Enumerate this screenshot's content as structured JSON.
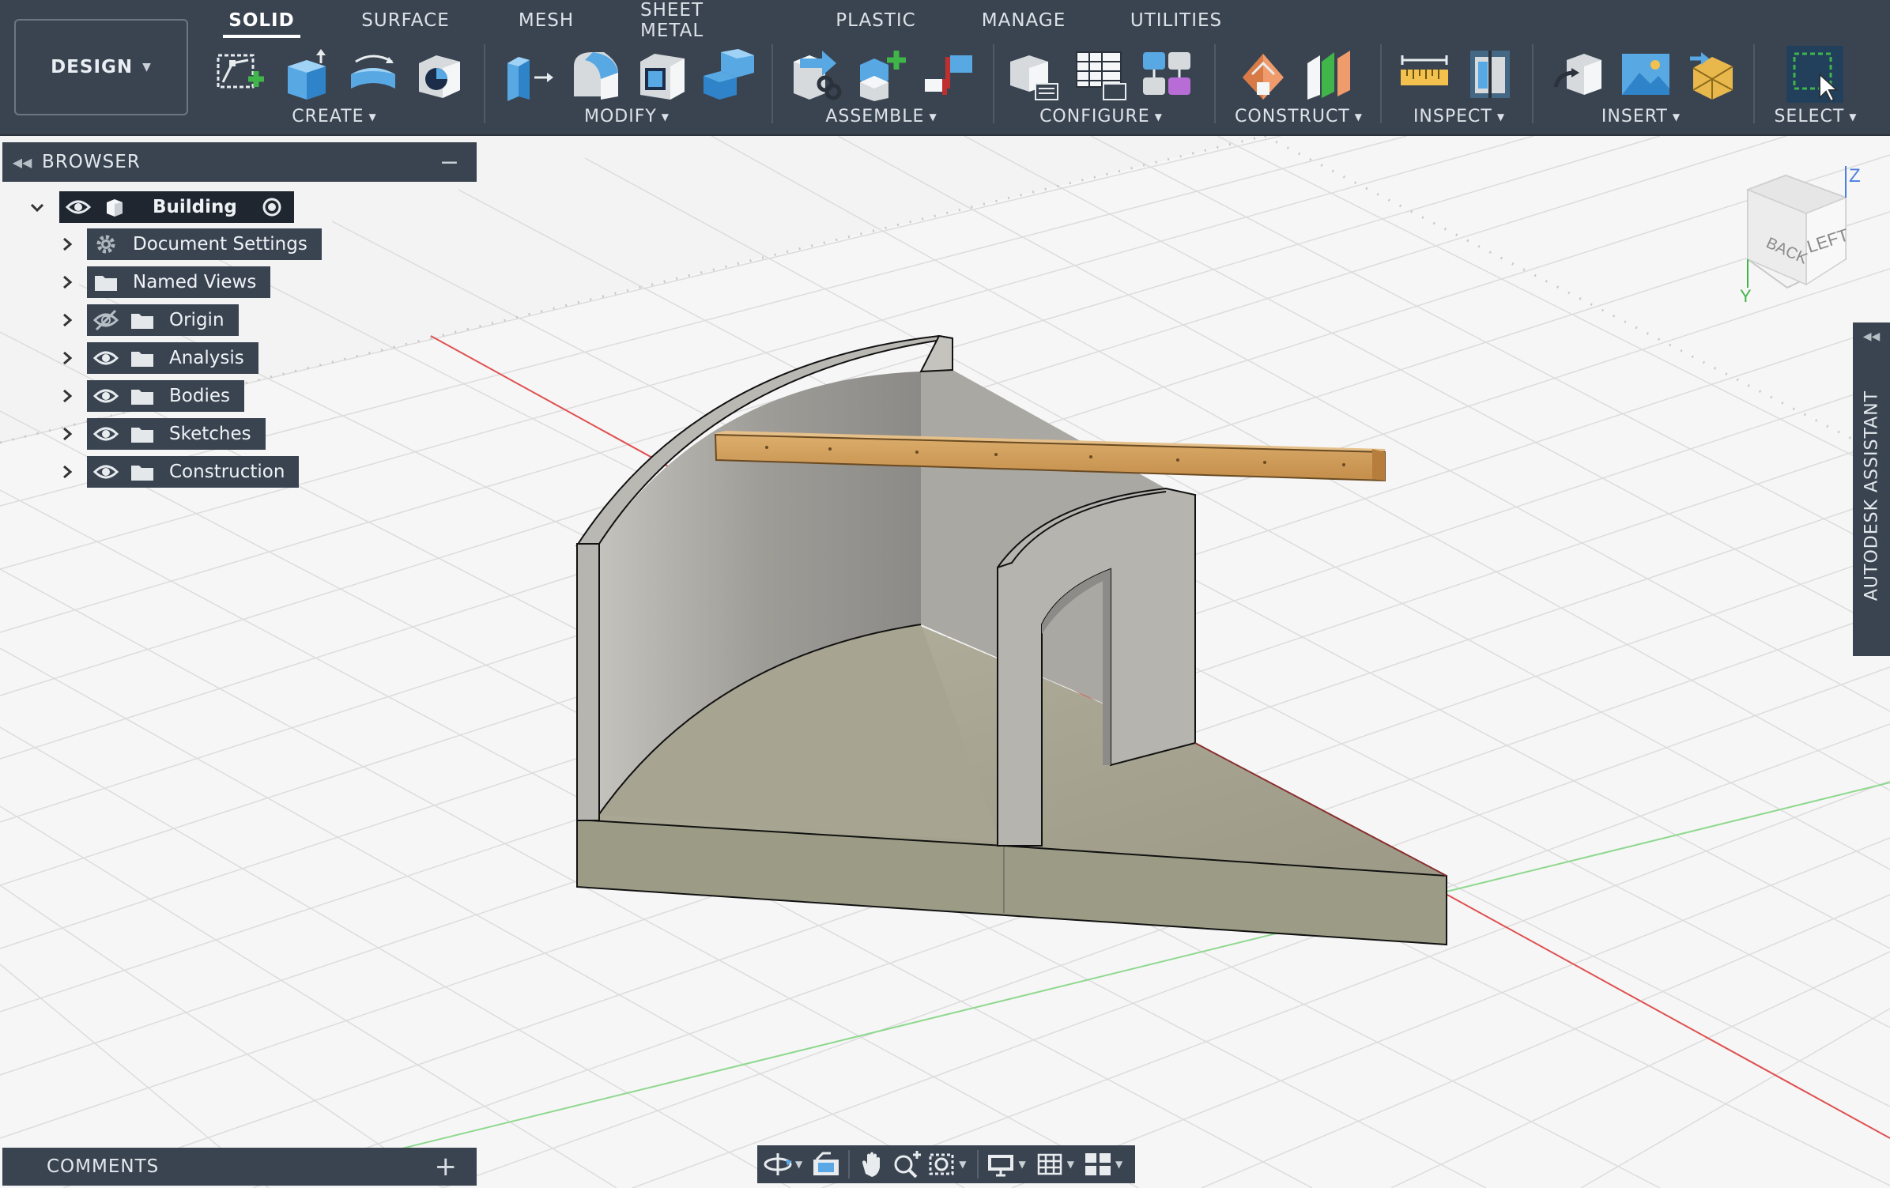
{
  "workspace": {
    "label": "DESIGN"
  },
  "tabs": [
    {
      "label": "SOLID",
      "active": true
    },
    {
      "label": "SURFACE"
    },
    {
      "label": "MESH"
    },
    {
      "label": "SHEET METAL"
    },
    {
      "label": "PLASTIC"
    },
    {
      "label": "MANAGE"
    },
    {
      "label": "UTILITIES"
    }
  ],
  "groups": {
    "create": {
      "label": "CREATE",
      "icons": [
        "create-sketch-icon",
        "extrude-icon",
        "revolve-icon",
        "hole-icon"
      ]
    },
    "modify": {
      "label": "MODIFY",
      "icons": [
        "press-pull-icon",
        "fillet-icon",
        "shell-icon",
        "combine-icon"
      ]
    },
    "assemble": {
      "label": "ASSEMBLE",
      "icons": [
        "joint-icon",
        "new-component-icon",
        "as-built-joint-icon"
      ]
    },
    "configure": {
      "label": "CONFIGURE",
      "icons": [
        "configure-component-icon",
        "configuration-table-icon",
        "configuration-rule-icon"
      ]
    },
    "construct": {
      "label": "CONSTRUCT",
      "icons": [
        "offset-plane-icon",
        "midplane-icon"
      ]
    },
    "inspect": {
      "label": "INSPECT",
      "icons": [
        "measure-icon",
        "section-analysis-icon"
      ]
    },
    "insert": {
      "label": "INSERT",
      "icons": [
        "insert-derive-icon",
        "insert-canvas-icon",
        "insert-mesh-icon"
      ]
    },
    "select": {
      "label": "SELECT",
      "icons": [
        "window-select-icon"
      ]
    }
  },
  "browser": {
    "title": "BROWSER",
    "root": {
      "label": "Building"
    },
    "items": [
      {
        "label": "Document Settings",
        "icon": "gear-icon"
      },
      {
        "label": "Named Views",
        "icon": "folder-icon"
      },
      {
        "label": "Origin",
        "icon": "folder-icon",
        "visibility": "hidden"
      },
      {
        "label": "Analysis",
        "icon": "folder-icon",
        "visibility": "visible"
      },
      {
        "label": "Bodies",
        "icon": "folder-icon",
        "visibility": "visible"
      },
      {
        "label": "Sketches",
        "icon": "folder-icon",
        "visibility": "visible"
      },
      {
        "label": "Construction",
        "icon": "folder-icon",
        "visibility": "visible"
      }
    ]
  },
  "comments": {
    "label": "COMMENTS"
  },
  "assistant": {
    "label": "AUTODESK ASSISTANT"
  },
  "viewcube": {
    "face_back": "BACK",
    "face_left": "LEFT",
    "axis_z": "Z",
    "axis_y": "Y"
  },
  "navbar": {
    "tools": [
      "orbit-icon",
      "look-at-icon",
      "pan-icon",
      "zoom-icon",
      "fit-icon",
      "display-settings-icon",
      "grid-settings-icon",
      "viewports-icon"
    ]
  },
  "colors": {
    "toolbar_bg": "#3a4451",
    "panel_bg": "#3a4451",
    "accent_blue": "#5aa9e6",
    "wood": "#d09e5e",
    "concrete": "#a8a58f"
  }
}
